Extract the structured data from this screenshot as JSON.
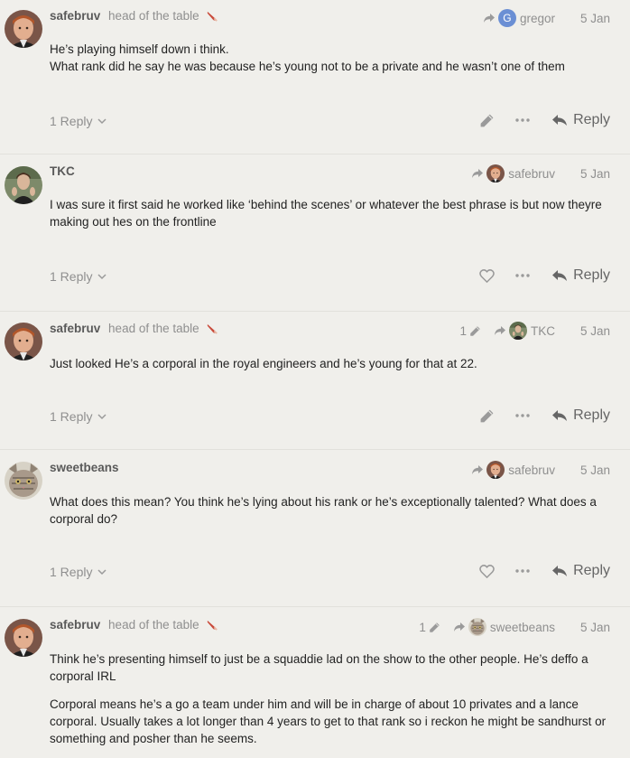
{
  "posts": [
    {
      "username": "safebruv",
      "user_title": "head of the table",
      "avatar": "avatar-safebruv",
      "flair": "flair-icon",
      "edit_count": "",
      "reply_to": {
        "name": "gregor",
        "avatar_letter": "G"
      },
      "date": "5 Jan",
      "paragraphs": [
        "He’s playing himself down i think.\nWhat rank did he say he was because he’s young not to be a private and he wasn’t one of them"
      ],
      "replies_label": "1 Reply",
      "action_icon": "edit-icon",
      "reply_label": "Reply"
    },
    {
      "username": "TKC",
      "user_title": "",
      "avatar": "avatar-tkc",
      "edit_count": "",
      "reply_to": {
        "name": "safebruv",
        "avatar_letter": ""
      },
      "date": "5 Jan",
      "paragraphs": [
        "I was sure it first said he worked like ‘behind the scenes’ or whatever the best phrase is but now theyre making out hes on the frontline"
      ],
      "replies_label": "1 Reply",
      "action_icon": "heart-icon",
      "reply_label": "Reply"
    },
    {
      "username": "safebruv",
      "user_title": "head of the table",
      "avatar": "avatar-safebruv",
      "flair": "flair-icon",
      "edit_count": "1",
      "reply_to": {
        "name": "TKC",
        "avatar_letter": ""
      },
      "date": "5 Jan",
      "paragraphs": [
        "Just looked He’s a corporal in the royal engineers and he’s young for that at 22."
      ],
      "replies_label": "1 Reply",
      "action_icon": "edit-icon",
      "reply_label": "Reply"
    },
    {
      "username": "sweetbeans",
      "user_title": "",
      "avatar": "avatar-sweetbeans",
      "edit_count": "",
      "reply_to": {
        "name": "safebruv",
        "avatar_letter": ""
      },
      "date": "5 Jan",
      "paragraphs": [
        "What does this mean? You think he’s lying about his rank or he’s exceptionally talented? What does a corporal do?"
      ],
      "replies_label": "1 Reply",
      "action_icon": "heart-icon",
      "reply_label": "Reply"
    },
    {
      "username": "safebruv",
      "user_title": "head of the table",
      "avatar": "avatar-safebruv",
      "flair": "flair-icon",
      "edit_count": "1",
      "reply_to": {
        "name": "sweetbeans",
        "avatar_letter": ""
      },
      "date": "5 Jan",
      "paragraphs": [
        "Think he’s presenting himself to just be a squaddie lad on the show to the other people. He’s deffo a corporal IRL",
        "Corporal means he’s a go a team under him and will be in charge of about 10 privates and a lance corporal. Usually takes a lot longer than 4 years to get to that rank so i reckon he might be sandhurst or something and posher than he seems."
      ]
    }
  ],
  "colors": {
    "background": "#f0efeb",
    "muted": "#8f8f8f",
    "gregor_avatar": "#6b8fd4"
  }
}
